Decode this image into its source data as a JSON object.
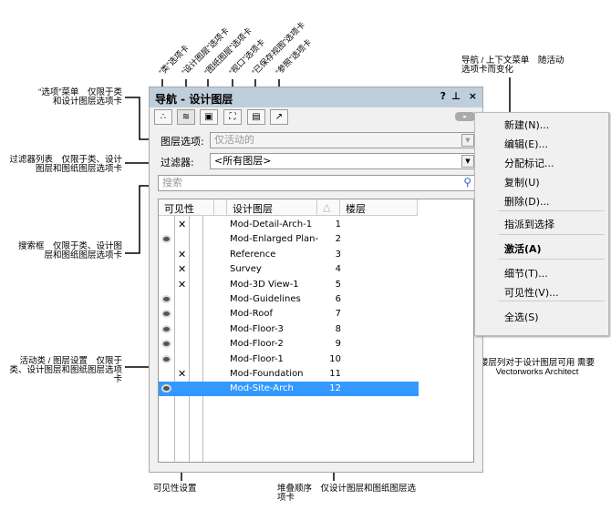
{
  "panel": {
    "title": "导航 - 设计图层",
    "title_buttons": [
      "?",
      "⊥",
      "×"
    ],
    "tabs": [
      {
        "icon": "classes-icon"
      },
      {
        "icon": "design-layers-icon"
      },
      {
        "icon": "sheet-layers-icon"
      },
      {
        "icon": "viewports-icon"
      },
      {
        "icon": "saved-views-icon"
      },
      {
        "icon": "references-icon"
      }
    ],
    "layer_options_label": "图层选项:",
    "layer_options_value": "仅活动的",
    "filter_label": "过滤器:",
    "filter_value": "<所有图层>",
    "search_placeholder": "搜索",
    "columns": [
      "可见性",
      "设计图层",
      "△",
      "楼层"
    ],
    "rows": [
      {
        "vis": "x",
        "name": "Mod-Detail-Arch-1",
        "order": "1"
      },
      {
        "vis": "eye",
        "name": "Mod-Enlarged Plan-",
        "order": "2"
      },
      {
        "vis": "x",
        "name": "Reference",
        "order": "3"
      },
      {
        "vis": "x",
        "name": "Survey",
        "order": "4"
      },
      {
        "vis": "x",
        "name": "Mod-3D View-1",
        "order": "5"
      },
      {
        "vis": "eye",
        "name": "Mod-Guidelines",
        "order": "6"
      },
      {
        "vis": "eye",
        "name": "Mod-Roof",
        "order": "7"
      },
      {
        "vis": "eye",
        "name": "Mod-Floor-3",
        "order": "8"
      },
      {
        "vis": "eye",
        "name": "Mod-Floor-2",
        "order": "9"
      },
      {
        "vis": "eye",
        "name": "Mod-Floor-1",
        "order": "10"
      },
      {
        "vis": "x",
        "name": "Mod-Foundation",
        "order": "11"
      },
      {
        "vis": "eye",
        "name": "Mod-Site-Arch",
        "order": "12",
        "selected": true
      }
    ],
    "selection_color": "#3399ff"
  },
  "menu": {
    "items": [
      "新建(N)...",
      "编辑(E)...",
      "分配标记...",
      "复制(U)",
      "删除(D)...",
      "指派到选择",
      "激活(A)",
      "细节(T)...",
      "可见性(V)...",
      "全选(S)"
    ]
  },
  "annotations": {
    "tabs": [
      "“类”选项卡",
      "“设计图层”选项卡",
      "“图纸图层”选项卡",
      "“视口”选项卡",
      "“已保存视图”选项卡",
      "“参照”选项卡"
    ],
    "options_menu": "“选项”菜单　仅限于类和设计图层选项卡",
    "filter_list": "过滤器列表　仅限于类、设计图层和图纸图层选项卡",
    "search_box": "搜索框　仅限于类、设计图层和图纸图层选项卡",
    "active": "活动类 / 图层设置　仅限于类、设计图层和图纸图层选项卡",
    "visibility": "可见性设置",
    "stack_order": "堆叠顺序　仅设计图层和图纸图层选项卡",
    "story": "楼层列对于设计图层可用 需要 Vectorworks Architect",
    "context_menu": "导航 / 上下文菜单　随活动选项卡而变化"
  }
}
